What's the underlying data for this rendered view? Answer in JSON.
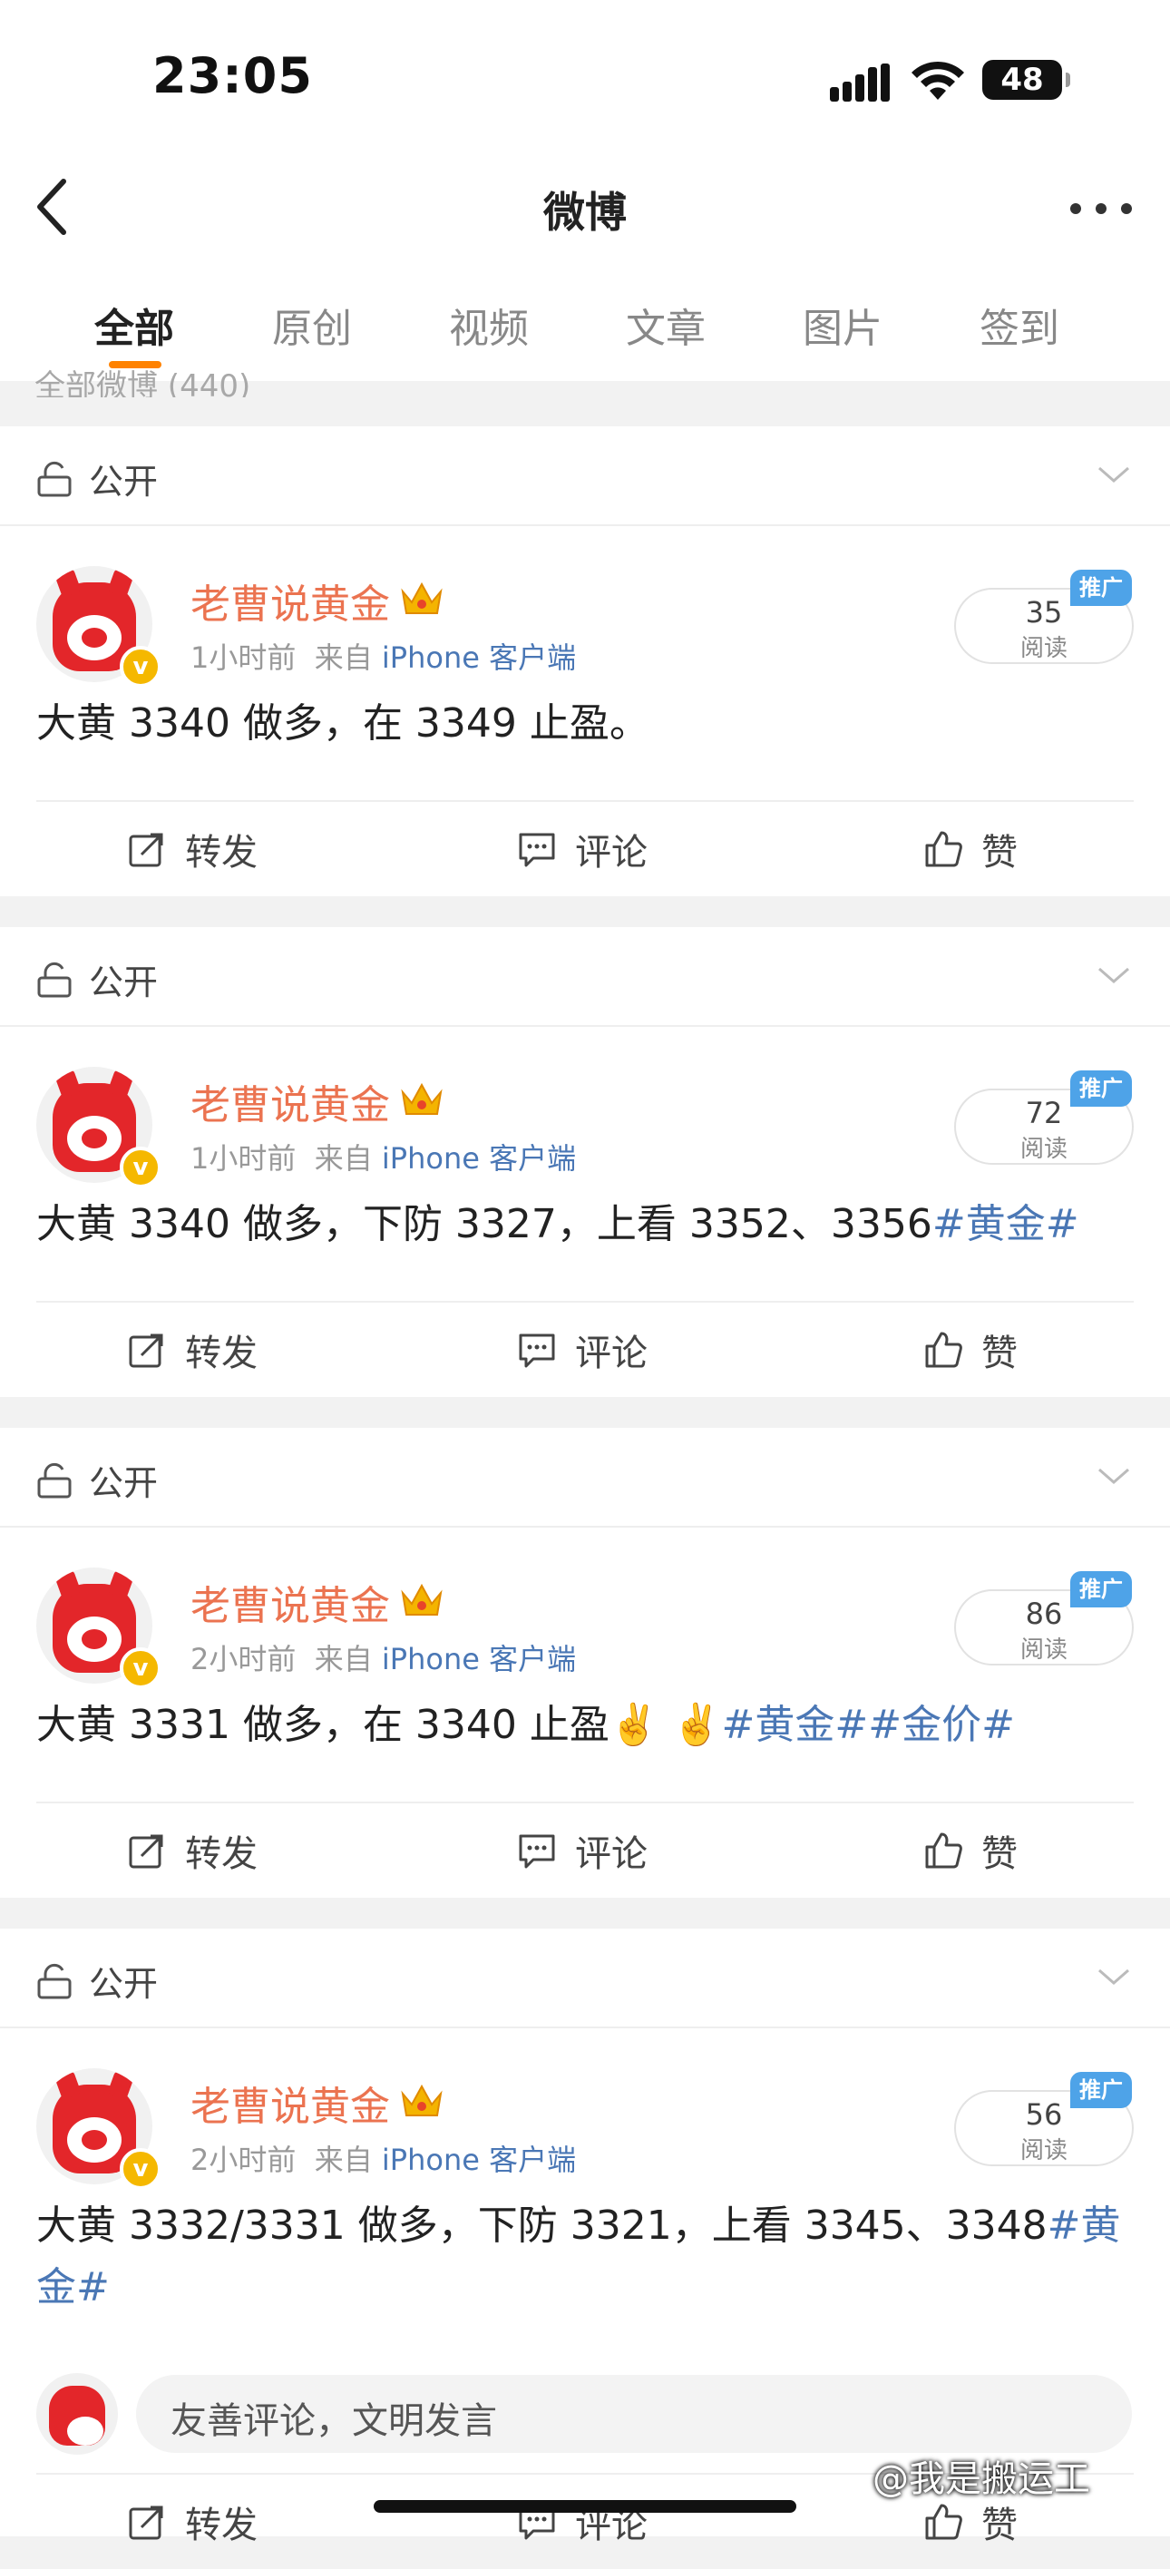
{
  "status_bar": {
    "time": "23:05",
    "battery": "48"
  },
  "nav": {
    "title": "微博"
  },
  "tabs": [
    "全部",
    "原创",
    "视频",
    "文章",
    "图片",
    "签到"
  ],
  "partial_header": "全部微博 (440)",
  "posts": [
    {
      "visibility": "公开",
      "username": "老曹说黄金",
      "time": "1小时前",
      "from_prefix": "来自",
      "source": "iPhone 客户端",
      "reads": "35",
      "reads_label": "阅读",
      "promo": "推广",
      "text": "大黄 3340 做多，在 3349 止盈。",
      "tags": ""
    },
    {
      "visibility": "公开",
      "username": "老曹说黄金",
      "time": "1小时前",
      "from_prefix": "来自",
      "source": "iPhone 客户端",
      "reads": "72",
      "reads_label": "阅读",
      "promo": "推广",
      "text": "大黄 3340 做多，下防 3327，上看 3352、3356",
      "tags": "#黄金#"
    },
    {
      "visibility": "公开",
      "username": "老曹说黄金",
      "time": "2小时前",
      "from_prefix": "来自",
      "source": "iPhone 客户端",
      "reads": "86",
      "reads_label": "阅读",
      "promo": "推广",
      "text": "大黄 3331 做多，在 3340 止盈",
      "emoji": "✌️ ✌️ ",
      "tags": "#黄金##金价#"
    },
    {
      "visibility": "公开",
      "username": "老曹说黄金",
      "time": "2小时前",
      "from_prefix": "来自",
      "source": "iPhone 客户端",
      "reads": "56",
      "reads_label": "阅读",
      "promo": "推广",
      "text": "大黄 3332/3331 做多，下防 3321，上看 3345、3348",
      "tags": "#黄金#"
    }
  ],
  "actions": {
    "repost": "转发",
    "comment": "评论",
    "like": "赞"
  },
  "comment_bar": {
    "placeholder": "友善评论，文明发言"
  },
  "watermark": "@我是搬运工",
  "icons": [
    "back-icon",
    "more-icon",
    "lock-icon",
    "chevron-down-icon",
    "crown-icon",
    "repost-icon",
    "comment-icon",
    "like-icon",
    "verified-icon"
  ]
}
